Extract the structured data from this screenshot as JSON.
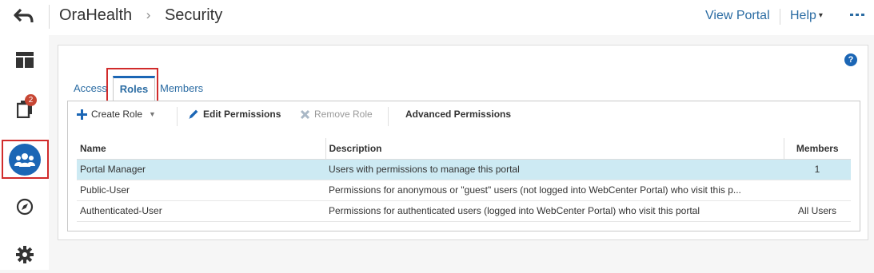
{
  "header": {
    "app_name": "OraHealth",
    "breadcrumb_separator": "›",
    "page_title": "Security",
    "view_portal_label": "View Portal",
    "help_label": "Help",
    "help_caret": "▾",
    "back_icon": "back-arrow-icon",
    "more_icon": "more-dots-icon"
  },
  "rail": {
    "items": [
      {
        "name": "layout",
        "icon": "layout-icon"
      },
      {
        "name": "pages",
        "icon": "pages-icon",
        "badge": "2"
      },
      {
        "name": "security",
        "icon": "people-icon",
        "active": true
      },
      {
        "name": "explore",
        "icon": "compass-icon"
      },
      {
        "name": "settings",
        "icon": "gear-icon"
      }
    ]
  },
  "panel": {
    "help_glyph": "?",
    "tabs": [
      {
        "label": "Access",
        "active": false
      },
      {
        "label": "Roles",
        "active": true
      },
      {
        "label": "Members",
        "active": false
      }
    ],
    "toolbar": {
      "create_role_label": "Create Role",
      "create_role_dropdown": "▼",
      "edit_permissions_label": "Edit Permissions",
      "remove_role_label": "Remove Role",
      "advanced_permissions_label": "Advanced Permissions"
    },
    "table": {
      "headers": {
        "name": "Name",
        "description": "Description",
        "members": "Members"
      },
      "rows": [
        {
          "name": "Portal Manager",
          "description": "Users with permissions to manage this portal",
          "members": "1",
          "selected": true
        },
        {
          "name": "Public-User",
          "description": "Permissions for anonymous or \"guest\" users (not logged into WebCenter Portal) who visit this p...",
          "members": "",
          "selected": false
        },
        {
          "name": "Authenticated-User",
          "description": "Permissions for authenticated users (logged into WebCenter Portal) who visit this portal",
          "members": "All Users",
          "selected": false
        }
      ]
    }
  },
  "colors": {
    "accent": "#1b66b5",
    "link": "#2b6ca3",
    "badge": "#c74634",
    "highlight_box": "#d12b2b",
    "selected_row": "#cdeaf3"
  }
}
